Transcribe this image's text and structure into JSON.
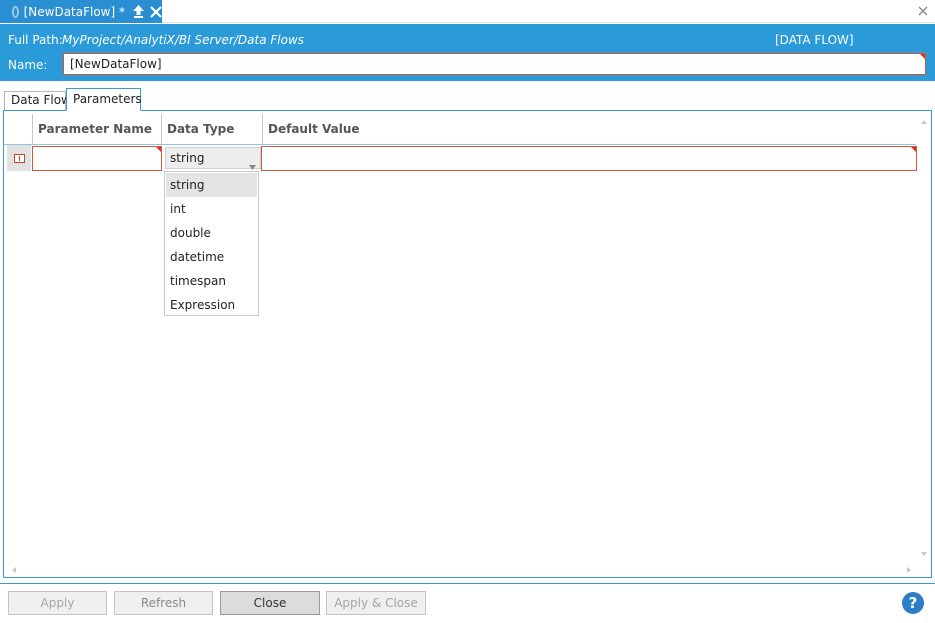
{
  "tab": {
    "title": "[NewDataFlow] *"
  },
  "header": {
    "full_path_label": "Full Path:",
    "full_path_value": "MyProject/AnalytiX/BI Server/Data Flows",
    "type_label": "[DATA FLOW]",
    "name_label": "Name:",
    "name_value": "[NewDataFlow]"
  },
  "inner_tabs": [
    "Data Flow",
    "Parameters"
  ],
  "grid": {
    "columns": [
      "Parameter Name",
      "Data Type",
      "Default Value"
    ],
    "row": {
      "parameter_name": "",
      "data_type": "string",
      "default_value": ""
    }
  },
  "dropdown": {
    "options": [
      "string",
      "int",
      "double",
      "datetime",
      "timespan",
      "Expression"
    ],
    "selected": "string"
  },
  "footer": {
    "apply": "Apply",
    "refresh": "Refresh",
    "close": "Close",
    "apply_close": "Apply & Close",
    "help": "?"
  },
  "colors": {
    "accent": "#2a9ad8",
    "error": "#e0301e"
  }
}
